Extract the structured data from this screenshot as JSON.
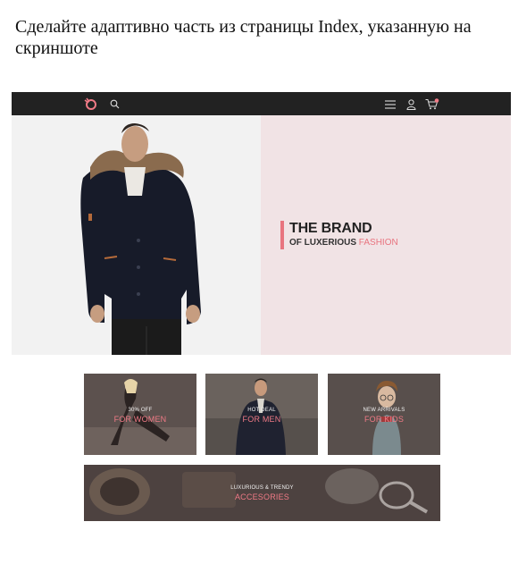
{
  "task": {
    "text": "Сделайте адаптивно часть из страницы Index, указанную на скриншоте"
  },
  "hero": {
    "brand_title": "THE BRAND",
    "brand_sub_prefix": "OF LUXERIOUS",
    "brand_sub_accent": "FASHION"
  },
  "categories": [
    {
      "small": "30% OFF",
      "big": "FOR WOMEN"
    },
    {
      "small": "HOT DEAL",
      "big": "FOR MEN"
    },
    {
      "small": "NEW ARRIVALS",
      "big": "FOR KIDS"
    },
    {
      "small": "LUXURIOUS & TRENDY",
      "big": "ACCESORIES"
    }
  ],
  "colors": {
    "nav_bg": "#222222",
    "accent": "#e8747f",
    "hero_right_bg": "#f1e3e5"
  },
  "icons": [
    "logo-icon",
    "search-icon",
    "menu-icon",
    "user-icon",
    "cart-icon"
  ]
}
